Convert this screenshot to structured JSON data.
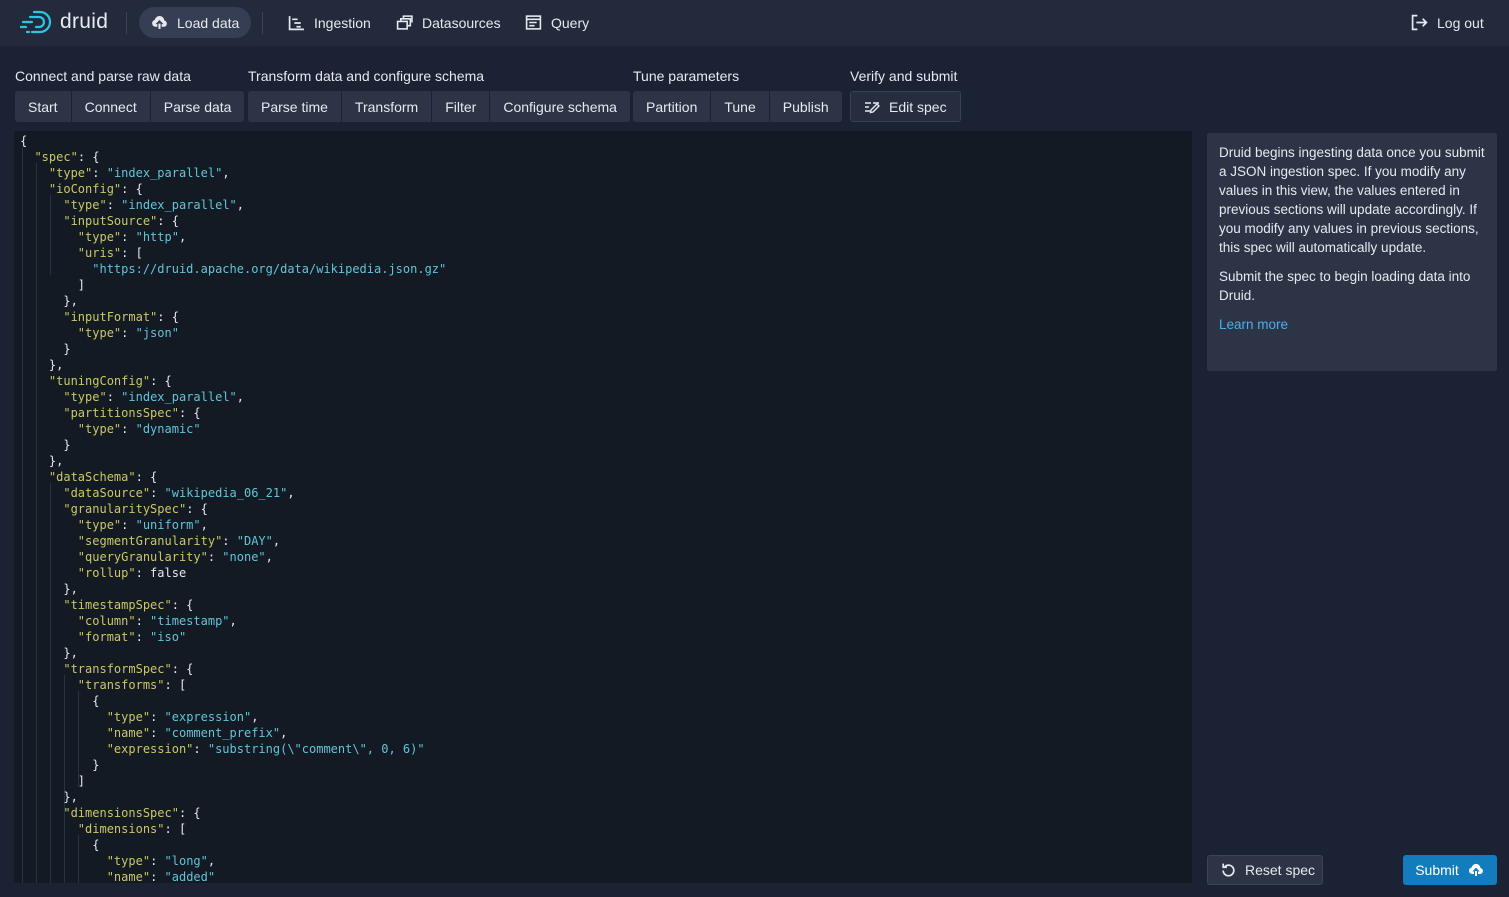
{
  "header": {
    "logo_text": "druid",
    "nav": {
      "load_data": "Load data",
      "ingestion": "Ingestion",
      "datasources": "Datasources",
      "query": "Query",
      "logout": "Log out"
    }
  },
  "steps": {
    "group1": {
      "title": "Connect and parse raw data",
      "items": [
        "Start",
        "Connect",
        "Parse data"
      ]
    },
    "group2": {
      "title": "Transform data and configure schema",
      "items": [
        "Parse time",
        "Transform",
        "Filter",
        "Configure schema"
      ]
    },
    "group3": {
      "title": "Tune parameters",
      "items": [
        "Partition",
        "Tune",
        "Publish"
      ]
    },
    "group4": {
      "title": "Verify and submit",
      "items": [
        "Edit spec"
      ]
    }
  },
  "editor": {
    "lines": [
      "{",
      "  \"spec\": {",
      "    \"type\": \"index_parallel\",",
      "    \"ioConfig\": {",
      "      \"type\": \"index_parallel\",",
      "      \"inputSource\": {",
      "        \"type\": \"http\",",
      "        \"uris\": [",
      "          \"https://druid.apache.org/data/wikipedia.json.gz\"",
      "        ]",
      "      },",
      "      \"inputFormat\": {",
      "        \"type\": \"json\"",
      "      }",
      "    },",
      "    \"tuningConfig\": {",
      "      \"type\": \"index_parallel\",",
      "      \"partitionsSpec\": {",
      "        \"type\": \"dynamic\"",
      "      }",
      "    },",
      "    \"dataSchema\": {",
      "      \"dataSource\": \"wikipedia_06_21\",",
      "      \"granularitySpec\": {",
      "        \"type\": \"uniform\",",
      "        \"segmentGranularity\": \"DAY\",",
      "        \"queryGranularity\": \"none\",",
      "        \"rollup\": false",
      "      },",
      "      \"timestampSpec\": {",
      "        \"column\": \"timestamp\",",
      "        \"format\": \"iso\"",
      "      },",
      "      \"transformSpec\": {",
      "        \"transforms\": [",
      "          {",
      "            \"type\": \"expression\",",
      "            \"name\": \"comment_prefix\",",
      "            \"expression\": \"substring(\\\"comment\\\", 0, 6)\"",
      "          }",
      "        ]",
      "      },",
      "      \"dimensionsSpec\": {",
      "        \"dimensions\": [",
      "          {",
      "            \"type\": \"long\",",
      "            \"name\": \"added\""
    ]
  },
  "info": {
    "paragraph1": "Druid begins ingesting data once you submit a JSON ingestion spec. If you modify any values in this view, the values entered in previous sections will update accordingly. If you modify any values in previous sections, this spec will automatically update.",
    "paragraph2": "Submit the spec to begin loading data into Druid.",
    "link": "Learn more"
  },
  "actions": {
    "reset": "Reset spec",
    "submit": "Submit"
  },
  "colors": {
    "background": "#1b2233",
    "header": "#232a3b",
    "button": "#2c3446",
    "editor_bg": "#141a24",
    "json_key": "#c9c960",
    "json_string": "#5fc6d8",
    "link": "#48aff0",
    "primary": "#137cbd"
  }
}
